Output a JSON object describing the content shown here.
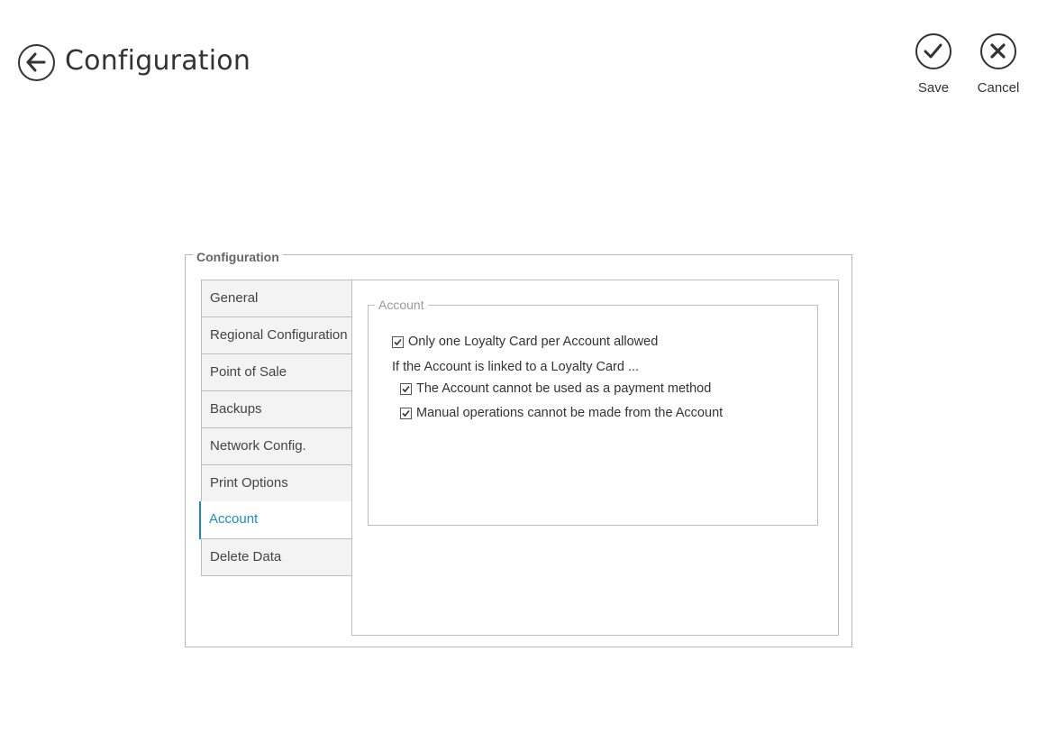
{
  "header": {
    "title": "Configuration",
    "back_icon": "arrow-left-icon"
  },
  "commands": {
    "save_label": "Save",
    "cancel_label": "Cancel"
  },
  "group": {
    "legend": "Configuration"
  },
  "tabs": [
    {
      "label": "General",
      "active": false
    },
    {
      "label": "Regional Configuration",
      "active": false
    },
    {
      "label": "Point of Sale",
      "active": false
    },
    {
      "label": "Backups",
      "active": false
    },
    {
      "label": "Network Config.",
      "active": false
    },
    {
      "label": "Print Options",
      "active": false
    },
    {
      "label": "Account",
      "active": true
    },
    {
      "label": "Delete Data",
      "active": false
    }
  ],
  "account": {
    "legend": "Account",
    "only_one_card": {
      "label": "Only one Loyalty Card per Account allowed",
      "checked": true
    },
    "linked_text": "If the Account is linked to a Loyalty Card ...",
    "no_payment": {
      "label": "The Account cannot be used as a payment method",
      "checked": true
    },
    "no_manual_ops": {
      "label": "Manual operations cannot be made from the Account",
      "checked": true
    }
  },
  "colors": {
    "accent": "#1e8bc3",
    "border": "#bdbdbd",
    "tab_bg": "#f3f3f3"
  }
}
